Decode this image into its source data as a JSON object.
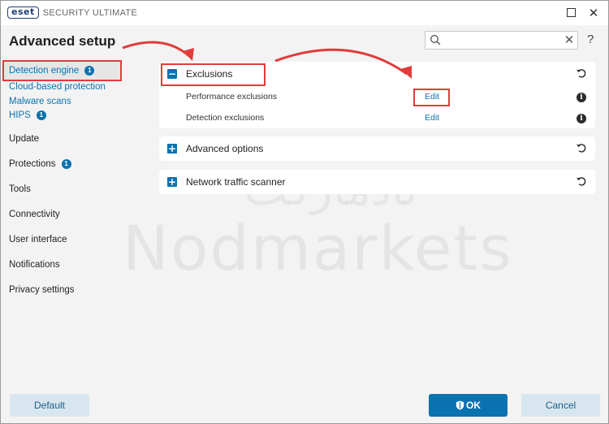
{
  "window": {
    "logo_badge": "eset",
    "product_name": "SECURITY ULTIMATE",
    "minimize_icon": "maximize-icon",
    "close_icon": "close-icon",
    "close_glyph": "✕"
  },
  "header": {
    "title": "Advanced setup",
    "search": {
      "value": "",
      "placeholder": "",
      "clear_glyph": "✕"
    },
    "help": "?"
  },
  "sidebar": {
    "items": [
      {
        "label": "Detection engine",
        "badge": "1",
        "active": true
      },
      {
        "label": "Cloud-based protection"
      },
      {
        "label": "Malware scans"
      },
      {
        "label": "HIPS",
        "badge": "1"
      },
      {
        "label": "Update"
      },
      {
        "label": "Protections",
        "badge": "1"
      },
      {
        "label": "Tools"
      },
      {
        "label": "Connectivity"
      },
      {
        "label": "User interface"
      },
      {
        "label": "Notifications"
      },
      {
        "label": "Privacy settings"
      }
    ]
  },
  "main": {
    "exclusions": {
      "title": "Exclusions",
      "toggle": "−",
      "rows": [
        {
          "label": "Performance exclusions",
          "action": "Edit",
          "info": "i"
        },
        {
          "label": "Detection exclusions",
          "action": "Edit",
          "info": "i"
        }
      ]
    },
    "advanced_options": {
      "title": "Advanced options",
      "toggle": "+"
    },
    "network_traffic_scanner": {
      "title": "Network traffic scanner",
      "toggle": "+"
    }
  },
  "watermark": {
    "persian": "نادمارکت",
    "english": "Nodmarkets"
  },
  "footer": {
    "default_label": "Default",
    "ok_label": "OK",
    "cancel_label": "Cancel"
  },
  "colors": {
    "accent": "#0b72b0",
    "highlight": "#e23b3b",
    "background": "#f3f3f3",
    "panel": "#ffffff",
    "secondary_button": "#d8e6ef"
  }
}
